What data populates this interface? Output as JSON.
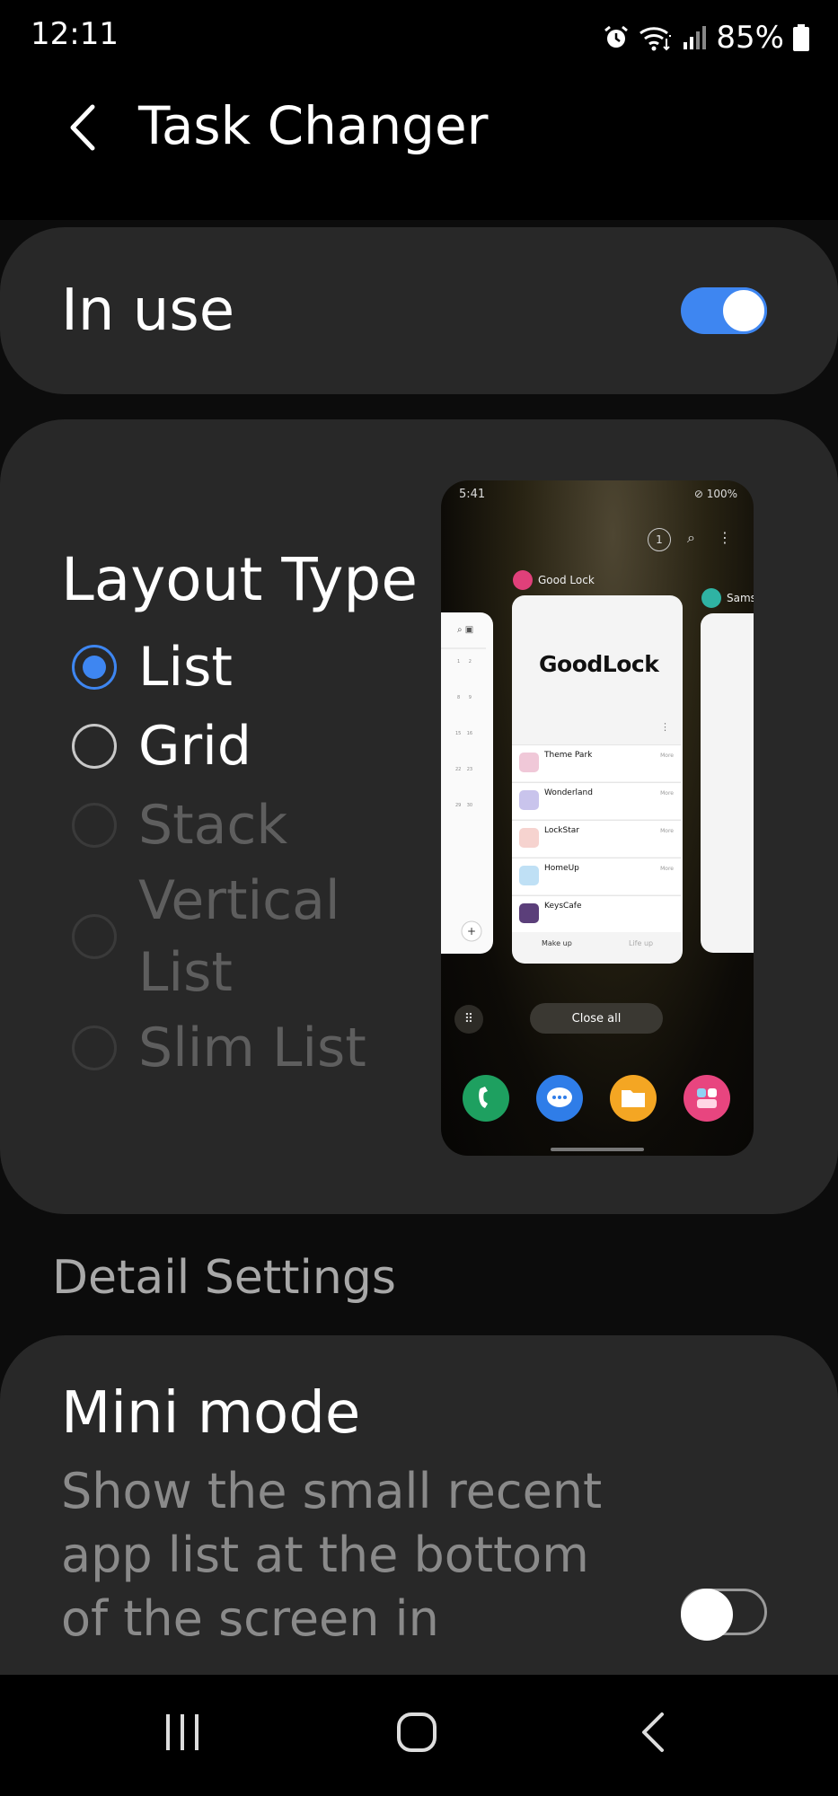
{
  "status_bar": {
    "time": "12:11",
    "battery": "85%",
    "icons": [
      "alarm-icon",
      "wifi-icon",
      "signal-icon",
      "battery-icon"
    ]
  },
  "header": {
    "title": "Task Changer",
    "back_icon": "chevron-left-icon"
  },
  "in_use": {
    "label": "In use",
    "enabled": true
  },
  "layout_type": {
    "title": "Layout Type",
    "options": [
      {
        "label": "List",
        "selected": true,
        "enabled": true
      },
      {
        "label": "Grid",
        "selected": false,
        "enabled": true
      },
      {
        "label": "Stack",
        "selected": false,
        "enabled": false
      },
      {
        "label": "Vertical List",
        "selected": false,
        "enabled": false
      },
      {
        "label": "Slim List",
        "selected": false,
        "enabled": false
      }
    ]
  },
  "preview": {
    "time": "5:41",
    "status": "100%",
    "recent_count": "1",
    "center_app": "Good Lock",
    "center_title": "GoodLock",
    "right_app": "Sams",
    "items": [
      {
        "name": "Theme Park",
        "more": "More"
      },
      {
        "name": "Wonderland",
        "more": "More"
      },
      {
        "name": "LockStar",
        "more": "More"
      },
      {
        "name": "HomeUp",
        "more": "More"
      },
      {
        "name": "KeysCafe",
        "more": ""
      }
    ],
    "bottom_left": "Make up",
    "bottom_right": "Life up",
    "close_all": "Close all"
  },
  "detail_settings": {
    "section_title": "Detail Settings",
    "mini_mode": {
      "title": "Mini mode",
      "description": "Show the small recent app list at the bottom of the screen in",
      "enabled": false
    }
  },
  "nav_bar": {
    "recents_icon": "recents-icon",
    "home_icon": "home-icon",
    "back_icon": "back-icon"
  },
  "colors": {
    "accent": "#3e86f1",
    "card": "#282828",
    "background": "#000000"
  }
}
